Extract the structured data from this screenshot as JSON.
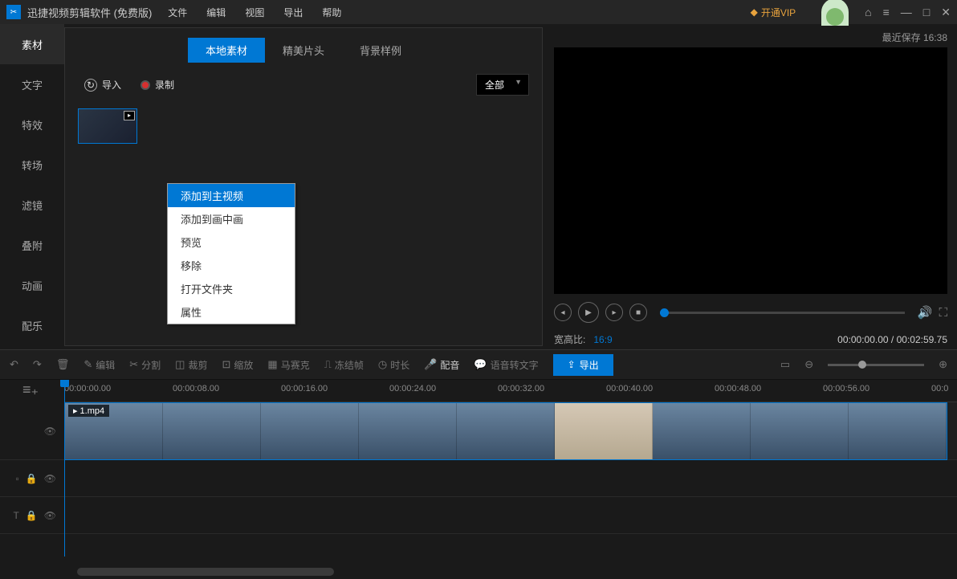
{
  "titlebar": {
    "title": "迅捷视频剪辑软件 (免费版)",
    "menus": [
      "文件",
      "编辑",
      "视图",
      "导出",
      "帮助"
    ],
    "vip_label": "开通VIP"
  },
  "sidebar": {
    "items": [
      {
        "label": "素材",
        "active": true
      },
      {
        "label": "文字"
      },
      {
        "label": "特效"
      },
      {
        "label": "转场"
      },
      {
        "label": "滤镜"
      },
      {
        "label": "叠附"
      },
      {
        "label": "动画"
      },
      {
        "label": "配乐"
      }
    ]
  },
  "media_panel": {
    "tabs": [
      {
        "label": "本地素材",
        "active": true
      },
      {
        "label": "精美片头"
      },
      {
        "label": "背景样例"
      }
    ],
    "import_label": "导入",
    "record_label": "录制",
    "filter_selected": "全部"
  },
  "context_menu": {
    "items": [
      {
        "label": "添加到主视频",
        "hover": true
      },
      {
        "label": "添加到画中画"
      },
      {
        "label": "预览"
      },
      {
        "label": "移除"
      },
      {
        "label": "打开文件夹"
      },
      {
        "label": "属性"
      }
    ]
  },
  "preview": {
    "save_info": "最近保存 16:38",
    "ratio_label": "宽高比:",
    "ratio_value": "16:9",
    "time_current": "00:00:00.00",
    "time_total": "00:02:59.75"
  },
  "toolbar": {
    "edit": "编辑",
    "split": "分割",
    "crop": "裁剪",
    "zoom": "缩放",
    "mosaic": "马赛克",
    "freeze": "冻结帧",
    "duration": "时长",
    "dub": "配音",
    "stt": "语音转文字",
    "export": "导出"
  },
  "timeline": {
    "ticks": [
      "00:00:00.00",
      "00:00:08.00",
      "00:00:16.00",
      "00:00:24.00",
      "00:00:32.00",
      "00:00:40.00",
      "00:00:48.00",
      "00:00:56.00",
      "00:0"
    ],
    "clip_name": "1.mp4"
  }
}
